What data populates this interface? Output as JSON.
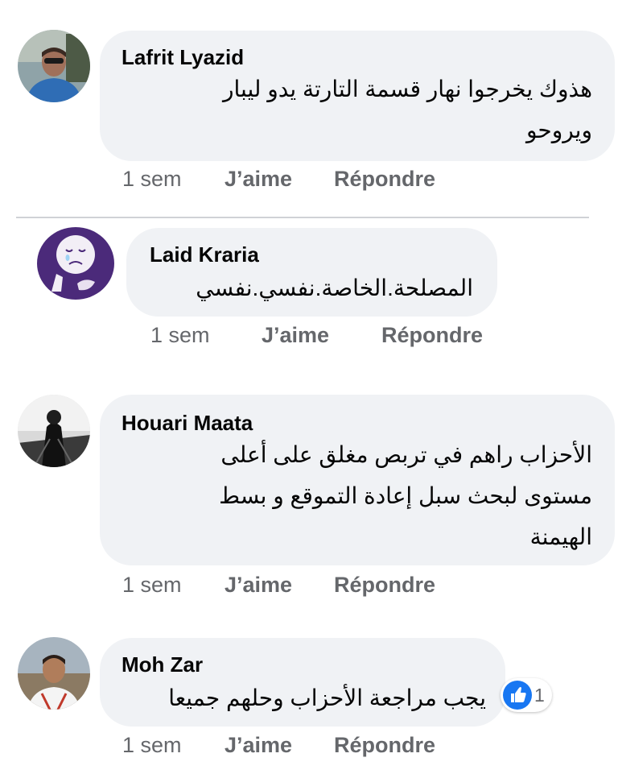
{
  "comments": [
    {
      "author": "Lafrit Lyazid",
      "lines": [
        "هذوك يخرجوا نهار قسمة التارتة يدو ليبار",
        "ويروحو"
      ],
      "time": "1 sem",
      "like_label": "J’aime",
      "reply_label": "Répondre"
    },
    {
      "author": "Laid Kraria",
      "lines": [
        "المصلحة.الخاصة.نفسي.نفسي"
      ],
      "time": "1 sem",
      "like_label": "J’aime",
      "reply_label": "Répondre"
    },
    {
      "author": "Houari Maata",
      "lines": [
        "الأحزاب راهم في تربص مغلق على أعلى",
        "مستوى لبحث سبل إعادة التموقع و بسط",
        "الهيمنة"
      ],
      "time": "1 sem",
      "like_label": "J’aime",
      "reply_label": "Répondre"
    },
    {
      "author": "Moh Zar",
      "lines": [
        "يجب مراجعة الأحزاب وحلهم جميعا"
      ],
      "time": "1 sem",
      "like_label": "J’aime",
      "reply_label": "Répondre",
      "reaction": {
        "icon": "thumbs-up-icon",
        "count": "1"
      }
    }
  ],
  "colors": {
    "bubble": "#f0f2f5",
    "meta_text": "#65676b",
    "like_blue": "#1877f2"
  }
}
